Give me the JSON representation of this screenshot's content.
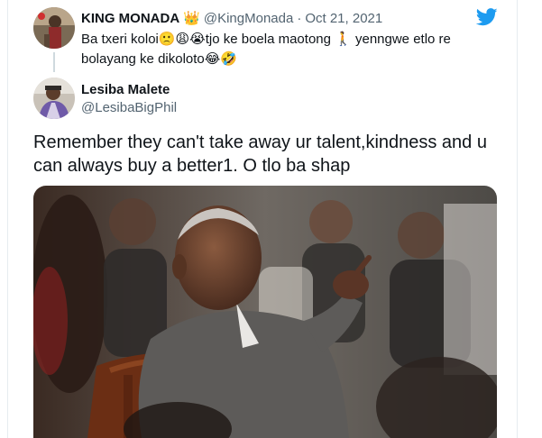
{
  "parent_tweet": {
    "name": "KING MONADA",
    "badge": "👑",
    "handle": "@KingMonada",
    "separator": "·",
    "date": "Oct 21, 2021",
    "text": "Ba txeri koloi🙁😩😭tjo ke boela maotong 🚶 yenngwe etlo re bolayang ke dikoloto😂🤣"
  },
  "tweet": {
    "name": "Lesiba Malete",
    "handle": "@LesibaBigPhil",
    "text": "Remember they can't take away ur talent,kindness and u can always buy a better1. O tlo ba shap"
  },
  "icons": {
    "twitter": "twitter-bird-icon"
  },
  "colors": {
    "brand_blue": "#1d9bf0",
    "text_primary": "#0f1419",
    "text_secondary": "#536471"
  }
}
